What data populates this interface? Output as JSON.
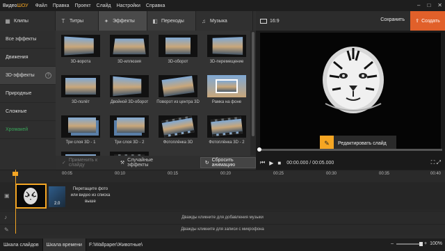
{
  "app": {
    "logo_part1": "Видео",
    "logo_part2": "ШОУ"
  },
  "menu": [
    "Файл",
    "Правка",
    "Проект",
    "Слайд",
    "Настройки",
    "Справка"
  ],
  "tabs": [
    {
      "label": "Клипы",
      "icon": "clips-icon"
    },
    {
      "label": "Титры",
      "icon": "text-icon"
    },
    {
      "label": "Эффекты",
      "icon": "effects-icon"
    },
    {
      "label": "Переходы",
      "icon": "transitions-icon"
    },
    {
      "label": "Музыка",
      "icon": "music-icon"
    }
  ],
  "sidebar": {
    "items": [
      {
        "label": "Все эффекты"
      },
      {
        "label": "Движения"
      },
      {
        "label": "3D-эффекты"
      },
      {
        "label": "Природные"
      },
      {
        "label": "Сложные"
      },
      {
        "label": "Хромакей"
      }
    ]
  },
  "effects": [
    {
      "label": "3D-ворота"
    },
    {
      "label": "3D-иллюзия"
    },
    {
      "label": "3D-оборот"
    },
    {
      "label": "3D-перемещение"
    },
    {
      "label": "3D-полёт"
    },
    {
      "label": "Двойной 3D-оборот"
    },
    {
      "label": "Поворот из центра 3D"
    },
    {
      "label": "Рамка на фоне"
    },
    {
      "label": "Три слоя 3D - 1"
    },
    {
      "label": "Три слоя 3D - 2"
    },
    {
      "label": "Фотоплёнка 3D"
    },
    {
      "label": "Фотоплёнка 3D - 2"
    }
  ],
  "bottom_buttons": {
    "apply": "Применить к слайду",
    "random": "Случайные эффекты",
    "reset": "Сбросить анимацию"
  },
  "preview": {
    "ratio": "16:9",
    "save": "Сохранить",
    "create": "Создать",
    "edit_slide": "Редактировать слайд",
    "time": "00:00.000 / 00:05.000"
  },
  "ruler": [
    "00:05",
    "00:10",
    "00:15",
    "00:20",
    "00:25",
    "00:30",
    "00:35",
    "00:40"
  ],
  "timeline": {
    "transition_duration": "2.0",
    "drop_hint": "Перетащите фото или видео из списка выше",
    "music_hint": "Дважды кликните для добавления музыки",
    "mic_hint": "Дважды кликните для записи с микрофона"
  },
  "status": {
    "tab1": "Шкала слайдов",
    "tab2": "Шкала времени",
    "path": "F:\\Wallpaper\\Животные\\",
    "zoom": "100%"
  },
  "colors": {
    "accent": "#f5a623",
    "create_button": "#e1602a",
    "green": "#3aa65a"
  }
}
